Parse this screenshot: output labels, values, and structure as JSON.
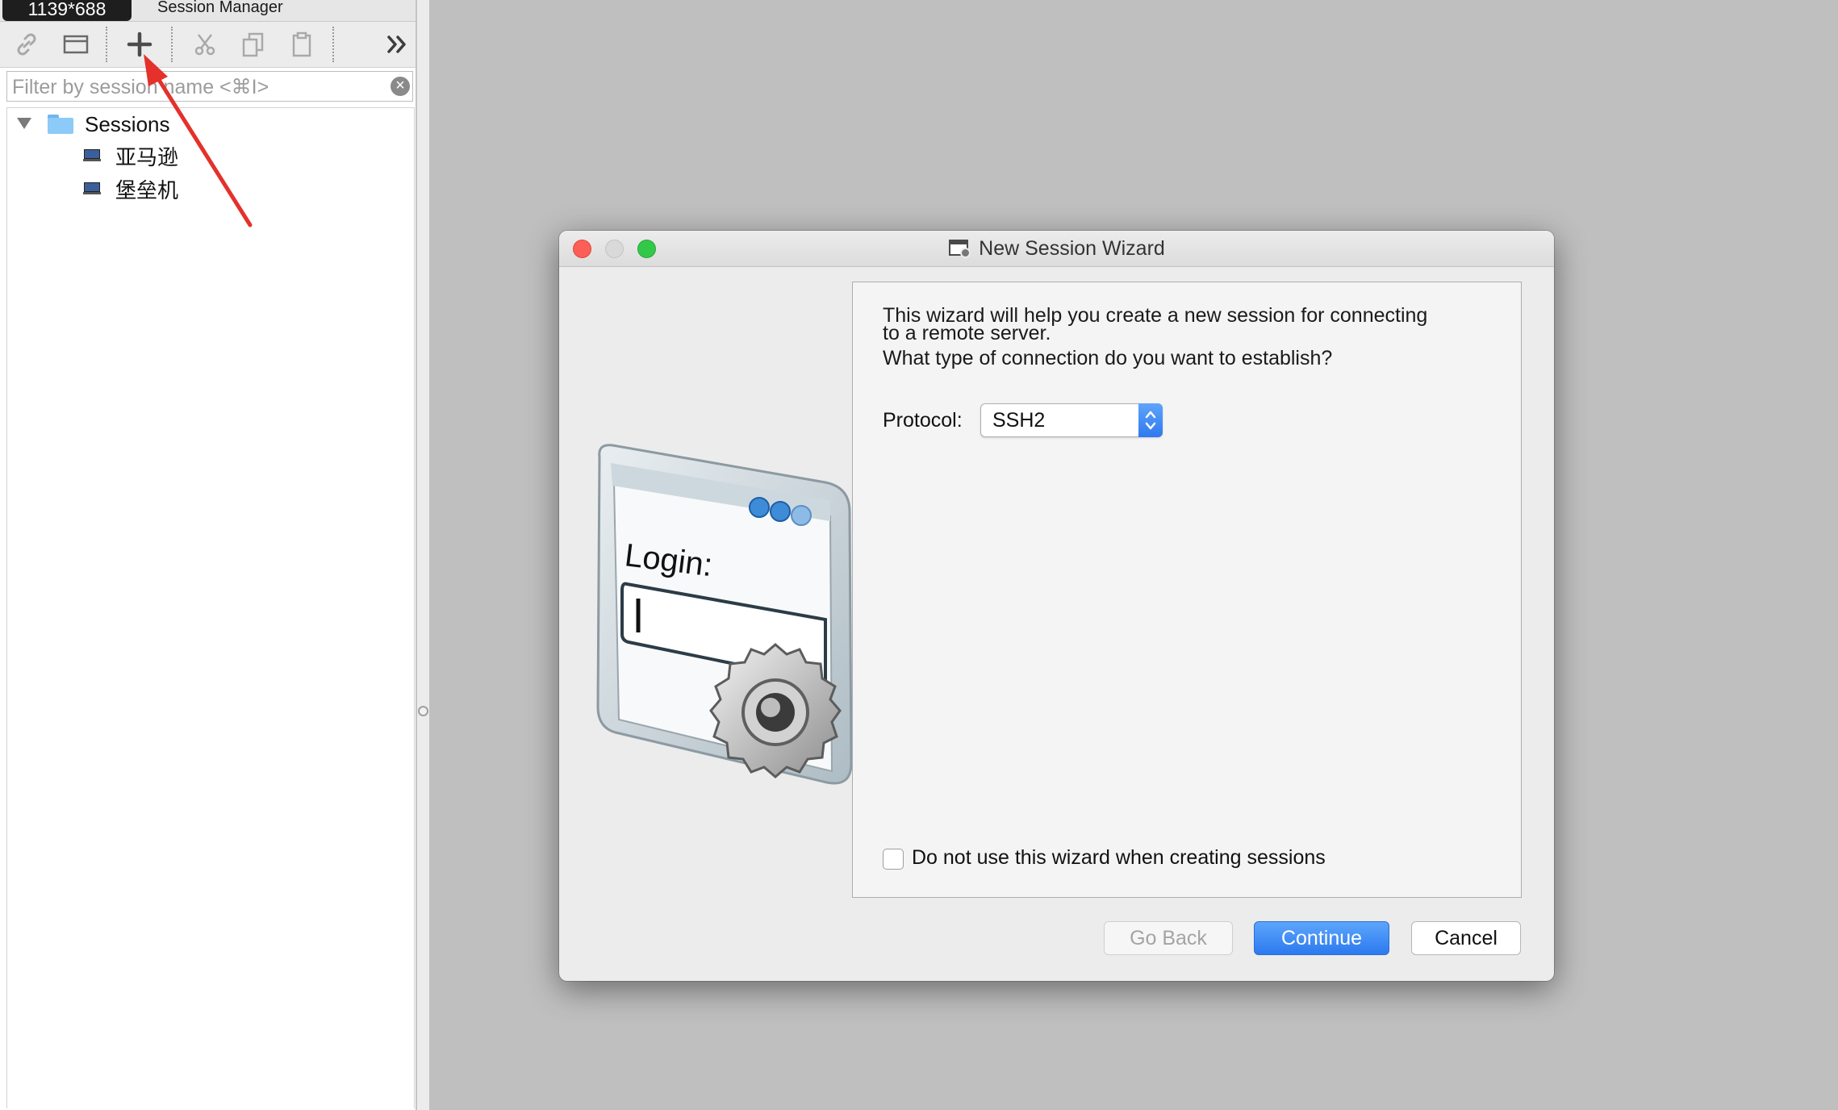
{
  "left_panel": {
    "dimension_badge": "1139*688",
    "title": "Session Manager",
    "toolbar": {
      "icons": [
        "link-icon",
        "window-icon",
        "plus-icon",
        "scissors-icon",
        "copy-icon",
        "clipboard-icon",
        "double-chevron-right-icon"
      ]
    },
    "filter": {
      "placeholder": "Filter by session name <⌘I>",
      "value": "",
      "clear_glyph": "×"
    },
    "tree": {
      "root_label": "Sessions",
      "items": [
        {
          "label": "亚马逊"
        },
        {
          "label": "堡垒机"
        }
      ]
    }
  },
  "annotation": {
    "arrow_color": "#e4312b"
  },
  "dialog": {
    "title": "New Session Wizard",
    "graphic_text": "Login:",
    "intro_line1": "This wizard will help you create a new session for connecting",
    "intro_line2": "to a remote server.",
    "question": "What type of connection do you want to establish?",
    "protocol_label": "Protocol:",
    "protocol_value": "SSH2",
    "checkbox_label": "Do not use this wizard when creating sessions",
    "checkbox_checked": false,
    "buttons": {
      "back": "Go Back",
      "continue": "Continue",
      "cancel": "Cancel"
    },
    "accent_color": "#2f79ef"
  }
}
